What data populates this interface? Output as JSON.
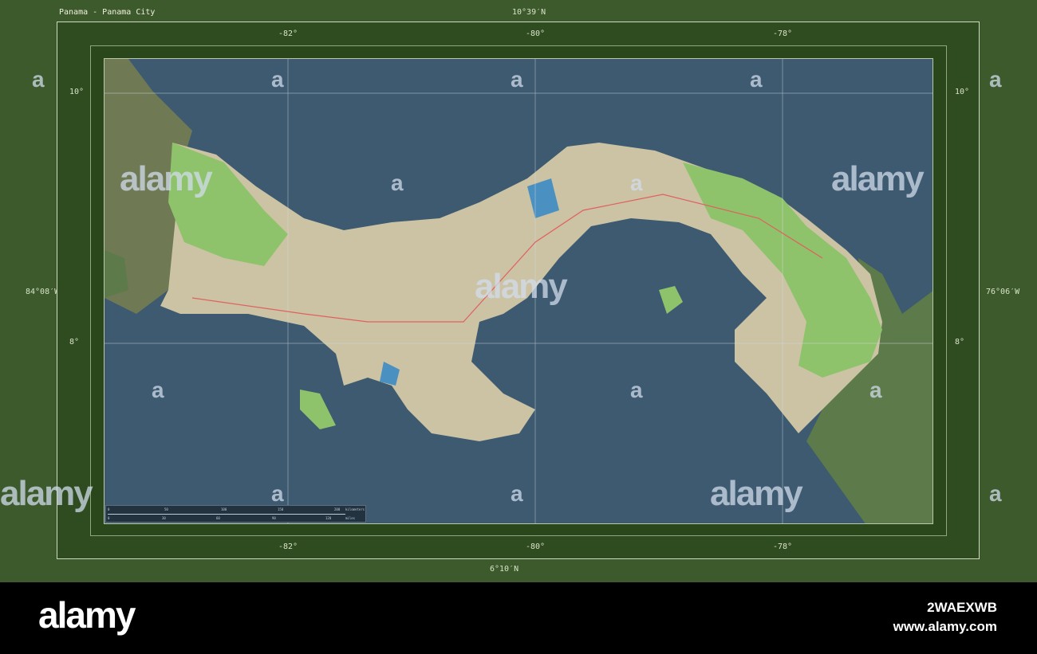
{
  "title": "Panama - Panama City",
  "bounds": {
    "north": "10°39′N",
    "south": "6°10′N",
    "west": "84°08′W",
    "east": "76°06′W"
  },
  "lon_ticks": [
    "-82°",
    "-80°",
    "-78°"
  ],
  "lat_ticks": [
    "10°",
    "8°"
  ],
  "scale_bar": {
    "km_ticks": [
      "0",
      "50",
      "100",
      "150",
      "200"
    ],
    "km_unit": "kilometers",
    "mi_ticks": [
      "0",
      "30",
      "60",
      "90",
      "120"
    ],
    "mi_unit": "miles"
  },
  "watermark": {
    "logo": "alamy",
    "letter": "a",
    "image_id": "2WAEXWB",
    "url": "www.alamy.com"
  },
  "colors": {
    "ocean": "#3d5a70",
    "land": "#cbc3a4",
    "park": "#8fc36b",
    "neighbor": "#5d7a4a",
    "frame": "#3c5a2c"
  }
}
